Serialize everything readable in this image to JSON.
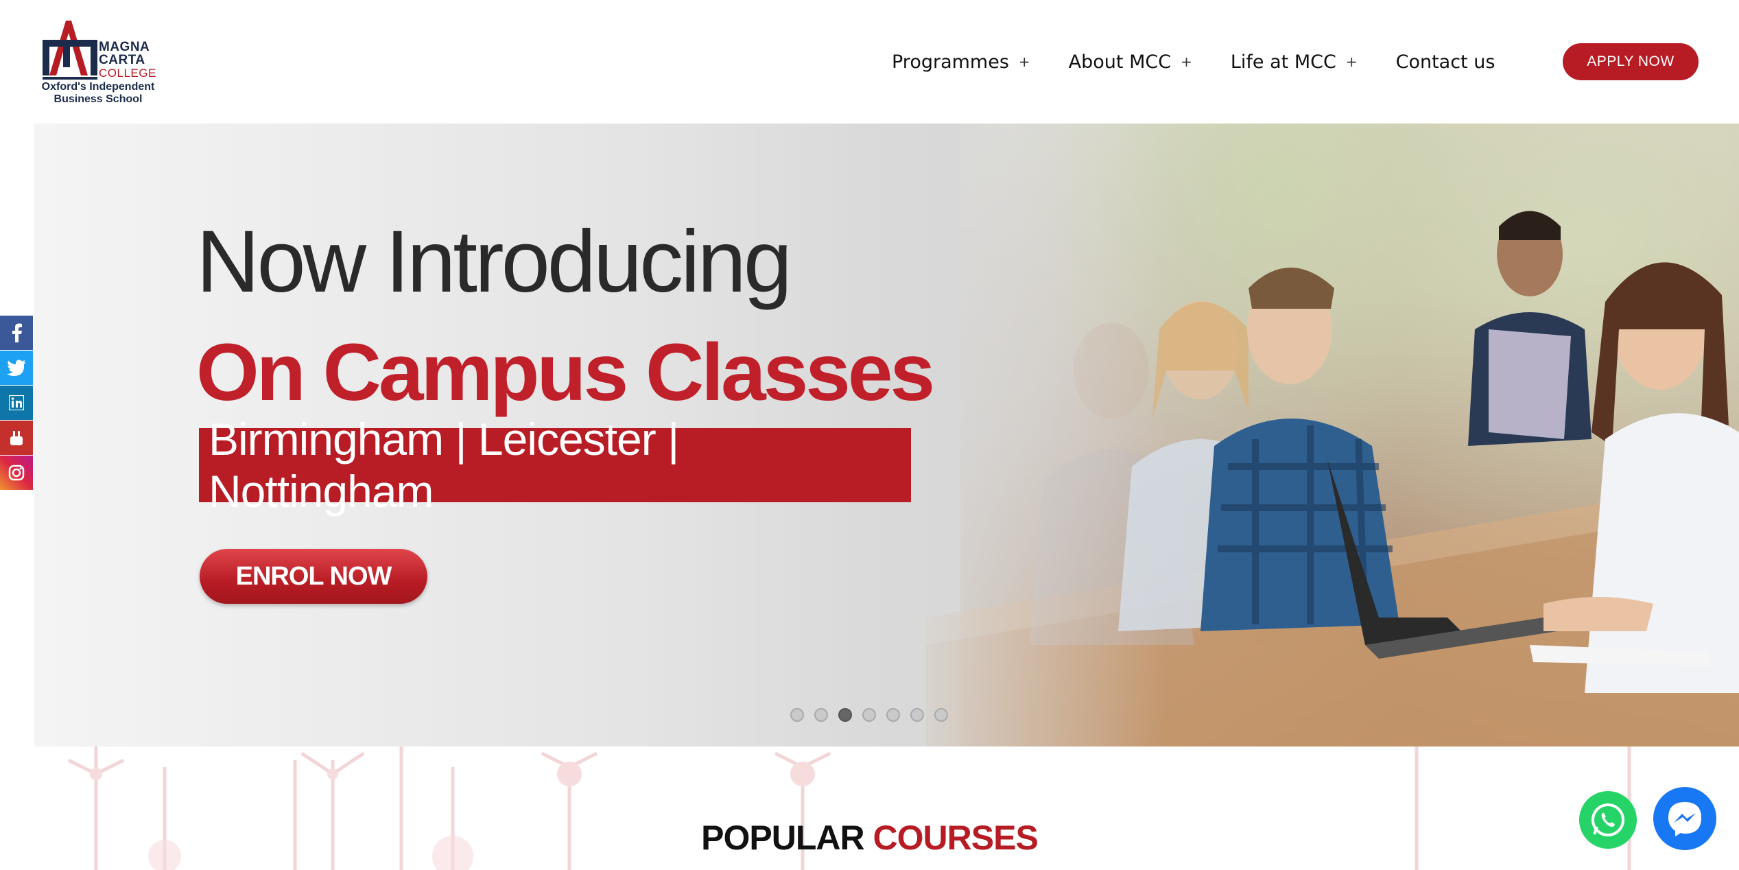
{
  "logo": {
    "line1": "MAGNA",
    "line2": "CARTA",
    "line3": "COLLEGE",
    "tagline1": "Oxford's Independent",
    "tagline2": "Business School"
  },
  "nav": {
    "items": [
      {
        "label": "Programmes",
        "has_submenu": true
      },
      {
        "label": "About MCC",
        "has_submenu": true
      },
      {
        "label": "Life at MCC",
        "has_submenu": true
      },
      {
        "label": "Contact us",
        "has_submenu": false
      }
    ],
    "submenu_glyph": "+",
    "apply_label": "APPLY NOW"
  },
  "hero": {
    "headline": "Now Introducing",
    "subheadline": "On Campus Classes",
    "locations": "Birmingham | Leicester | Nottingham",
    "cta": "ENROL NOW",
    "slide_count": 7,
    "active_slide": 3
  },
  "social": {
    "icons": [
      "facebook-icon",
      "twitter-icon",
      "linkedin-icon",
      "youtube-icon",
      "instagram-icon"
    ]
  },
  "section": {
    "title_part1": "POPULAR",
    "title_part2": "COURSES"
  },
  "chat": {
    "icons": [
      "whatsapp-icon",
      "messenger-icon"
    ]
  },
  "colors": {
    "brand_red": "#b71c24",
    "navy": "#1b2b4b",
    "whatsapp": "#25d366",
    "messenger": "#1877f2"
  }
}
